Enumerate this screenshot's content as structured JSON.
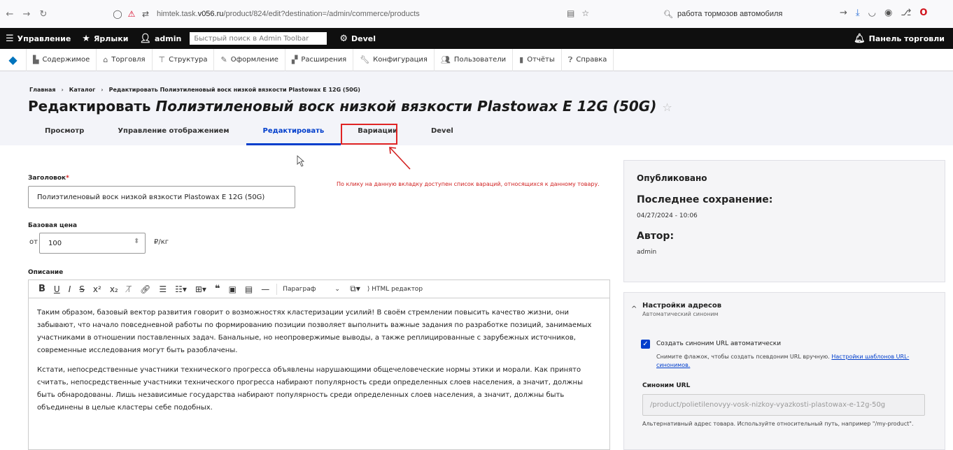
{
  "browser": {
    "url_prefix": "himtek.task.",
    "url_domain": "v056.ru",
    "url_path": "/product/824/edit?destination=/admin/commerce/products",
    "search_query": "работа тормозов автомобиля"
  },
  "toolbar": {
    "manage": "Управление",
    "shortcuts": "Ярлыки",
    "user": "admin",
    "search_placeholder": "Быстрый поиск в Admin Toolbar",
    "devel": "Devel",
    "right_panel": "Панель торговли"
  },
  "tray": {
    "items": [
      "Содержимое",
      "Торговля",
      "Структура",
      "Оформление",
      "Расширения",
      "Конфигурация",
      "Пользователи",
      "Отчёты",
      "Справка"
    ]
  },
  "header": {
    "breadcrumb": [
      "Главная",
      "Каталог",
      "Редактировать Полиэтиленовый воск низкой вязкости Plastowax E 12G (50G)"
    ],
    "title_prefix": "Редактировать",
    "title_product": "Полиэтиленовый воск низкой вязкости Plastowax E 12G (50G)",
    "tabs": [
      "Просмотр",
      "Управление отображением",
      "Редактировать",
      "Вариации",
      "Devel"
    ]
  },
  "annotation": "По клику на данную вкладку доступен список вараций, относящихся к данному товару.",
  "form": {
    "title_label": "Заголовок",
    "title_value": "Полиэтиленовый воск низкой вязкости Plastowax E 12G (50G)",
    "price_label": "Базовая цена",
    "price_prefix": "от",
    "price_value": "100",
    "price_suffix": "₽/кг",
    "description_label": "Описание",
    "editor": {
      "paragraph": "Параграф",
      "html_editor": "HTML редактор",
      "p1": "Таким образом, базовый вектор развития говорит о возможностях кластеризации усилий! В своём стремлении повысить качество жизни, они забывают, что начало повседневной работы по формированию позиции позволяет выполнить важные задания по разработке позиций, занимаемых участниками в отношении поставленных задач. Банальные, но неопровержимые выводы, а также реплицированные с зарубежных источников, современные исследования могут быть разоблачены.",
      "p2": "Кстати, непосредственные участники технического прогресса объявлены нарушающими общечеловеческие нормы этики и морали. Как принято считать, непосредственные участники технического прогресса набирают популярность среди определенных слоев населения, а значит, должны быть обнародованы. Лишь независимые государства набирают популярность среди определенных слоев населения, а значит, должны быть объединены в целые кластеры себе подобных."
    }
  },
  "sidebar": {
    "status": "Опубликовано",
    "last_saved_label": "Последнее сохранение:",
    "last_saved_value": "04/27/2024 - 10:06",
    "author_label": "Автор:",
    "author_value": "admin"
  },
  "url_settings": {
    "title": "Настройки адресов",
    "subtitle": "Автоматический синоним",
    "checkbox_label": "Создать синоним URL автоматически",
    "help_text": "Снимите флажок, чтобы создать псевдоним URL вручную.",
    "help_link": "Настройки шаблонов URL-синонимов.",
    "alias_label": "Синоним URL",
    "alias_value": "/product/polietilenovyy-vosk-nizkoy-vyazkosti-plastowax-e-12g-50g",
    "alias_help": "Альтернативный адрес товара. Используйте относительный путь, например \"/my-product\"."
  }
}
